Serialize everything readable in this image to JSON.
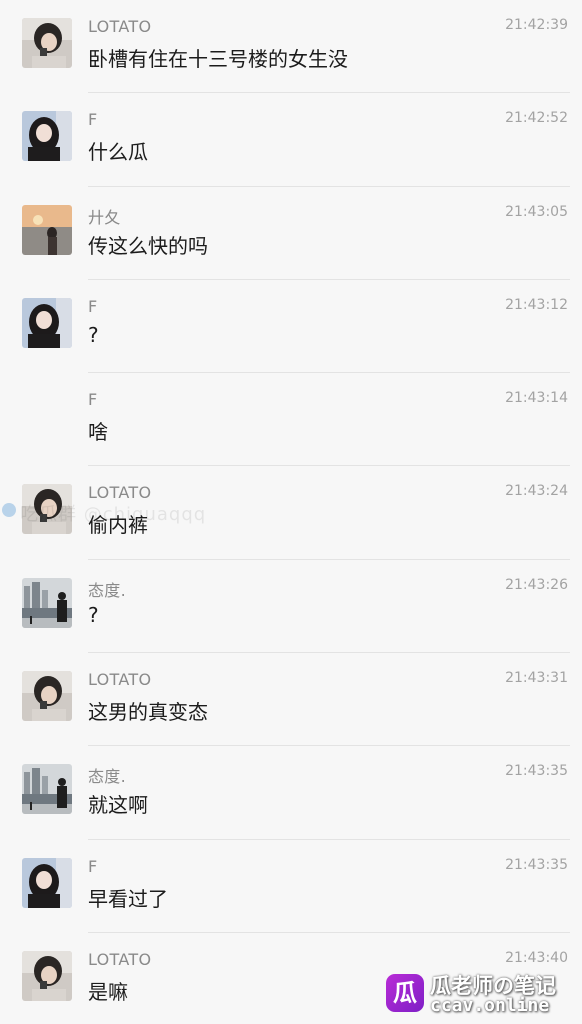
{
  "messages": [
    {
      "name": "LOTATO",
      "time": "21:42:39",
      "text": "卧槽有住在十三号楼的女生没",
      "avatar": "lotato-avatar"
    },
    {
      "name": "F",
      "time": "21:42:52",
      "text": "什么瓜",
      "avatar": "f-avatar"
    },
    {
      "name": "廾夂",
      "time": "21:43:05",
      "text": "传这么快的吗",
      "avatar": "sunset-avatar"
    },
    {
      "name": "F",
      "time": "21:43:12",
      "text": "?",
      "avatar": "f-avatar"
    },
    {
      "name": "F",
      "time": "21:43:14",
      "text": "啥",
      "avatar": ""
    },
    {
      "name": "LOTATO",
      "time": "21:43:24",
      "text": "偷内裤",
      "avatar": "lotato-avatar"
    },
    {
      "name": "态度.",
      "time": "21:43:26",
      "text": "?",
      "avatar": "city-avatar"
    },
    {
      "name": "LOTATO",
      "time": "21:43:31",
      "text": "这男的真变态",
      "avatar": "lotato-avatar"
    },
    {
      "name": "态度.",
      "time": "21:43:35",
      "text": "就这啊",
      "avatar": "city-avatar"
    },
    {
      "name": "F",
      "time": "21:43:35",
      "text": "早看过了",
      "avatar": "f-avatar"
    },
    {
      "name": "LOTATO",
      "time": "21:43:40",
      "text": "是嘛",
      "avatar": "lotato-avatar"
    }
  ],
  "watermark": {
    "text": "吃瓜群 @chiguaqqq",
    "icon": "telegram-icon"
  },
  "logo": {
    "badge": "瓜",
    "title": "瓜老师の笔记",
    "url": "ccav.online",
    "accent": "#a526d0"
  }
}
